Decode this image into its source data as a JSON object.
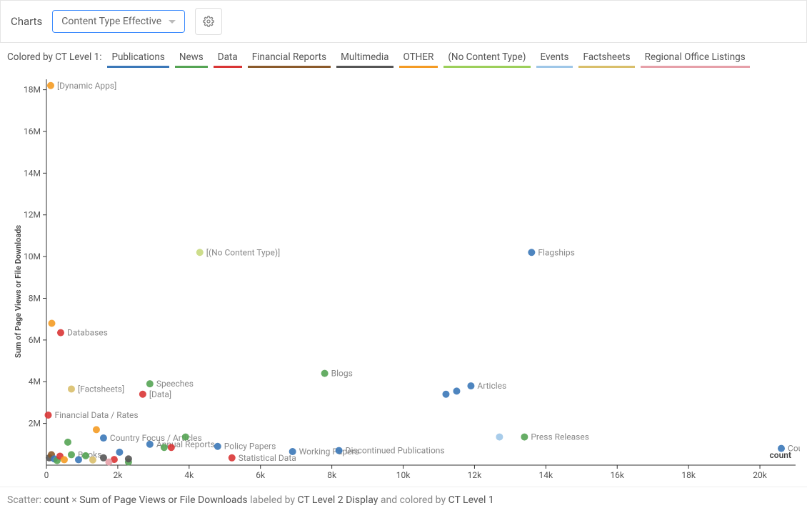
{
  "toolbar": {
    "label": "Charts",
    "dropdown_value": "Content Type Effective",
    "gear_name": "settings-icon"
  },
  "legend": {
    "label": "Colored by CT Level 1:",
    "items": [
      {
        "label": "Publications",
        "color": "#3B78B8"
      },
      {
        "label": "News",
        "color": "#55A454"
      },
      {
        "label": "Data",
        "color": "#D93535"
      },
      {
        "label": "Financial Reports",
        "color": "#8B5A2B"
      },
      {
        "label": "Multimedia",
        "color": "#555555"
      },
      {
        "label": "OTHER",
        "color": "#F49B24"
      },
      {
        "label": "(No Content Type)",
        "color": "#9CCF5A"
      },
      {
        "label": "Events",
        "color": "#9FC7E8"
      },
      {
        "label": "Factsheets",
        "color": "#D9BF6B"
      },
      {
        "label": "Regional Office Listings",
        "color": "#E6A0A9"
      }
    ]
  },
  "footer": {
    "prefix": "Scatter: ",
    "xvar": "count",
    "sep1": " × ",
    "yvar": "Sum of Page Views or File Downloads",
    "labeled_prefix": " labeled by ",
    "label_field": "CT Level 2 Display",
    "colored_prefix": " and colored by ",
    "color_field": "CT Level 1"
  },
  "chart_data": {
    "type": "scatter",
    "title": "",
    "xlabel": "count",
    "ylabel": "Sum of Page Views or File Downloads",
    "xlim": [
      0,
      21000
    ],
    "ylim": [
      0,
      18500000
    ],
    "xticks": [
      0,
      2000,
      4000,
      6000,
      8000,
      10000,
      12000,
      14000,
      16000,
      18000,
      20000
    ],
    "yticks": [
      2000000,
      4000000,
      6000000,
      8000000,
      10000000,
      12000000,
      14000000,
      16000000,
      18000000
    ],
    "xtick_labels": [
      "0",
      "2k",
      "4k",
      "6k",
      "8k",
      "10k",
      "12k",
      "14k",
      "16k",
      "18k",
      "20k"
    ],
    "ytick_labels": [
      "2M",
      "4M",
      "6M",
      "8M",
      "10M",
      "12M",
      "14M",
      "16M",
      "18M"
    ],
    "series_colors": {
      "Publications": "#3B78B8",
      "News": "#55A454",
      "Data": "#D93535",
      "Financial Reports": "#8B5A2B",
      "Multimedia": "#555555",
      "OTHER": "#F49B24",
      "(No Content Type)": "#C8D97E",
      "Events": "#9FC7E8",
      "Factsheets": "#D9BF6B",
      "Regional Office Listings": "#E6A0A9"
    },
    "points": [
      {
        "x": 120,
        "y": 18200000,
        "series": "OTHER",
        "label": "[Dynamic Apps]"
      },
      {
        "x": 4300,
        "y": 10200000,
        "series": "(No Content Type)",
        "label": "[(No Content Type)]"
      },
      {
        "x": 13600,
        "y": 10200000,
        "series": "Publications",
        "label": "Flagships"
      },
      {
        "x": 150,
        "y": 6800000,
        "series": "OTHER",
        "label": ""
      },
      {
        "x": 400,
        "y": 6350000,
        "series": "Data",
        "label": "Databases"
      },
      {
        "x": 7800,
        "y": 4400000,
        "series": "News",
        "label": "Blogs"
      },
      {
        "x": 11900,
        "y": 3800000,
        "series": "Publications",
        "label": "Articles"
      },
      {
        "x": 2900,
        "y": 3900000,
        "series": "News",
        "label": "Speeches"
      },
      {
        "x": 700,
        "y": 3650000,
        "series": "Factsheets",
        "label": "[Factsheets]"
      },
      {
        "x": 2700,
        "y": 3400000,
        "series": "Data",
        "label": "[Data]"
      },
      {
        "x": 11200,
        "y": 3400000,
        "series": "Publications",
        "label": ""
      },
      {
        "x": 11500,
        "y": 3550000,
        "series": "Publications",
        "label": ""
      },
      {
        "x": 50,
        "y": 2400000,
        "series": "Data",
        "label": "Financial Data / Rates"
      },
      {
        "x": 1400,
        "y": 1700000,
        "series": "OTHER",
        "label": ""
      },
      {
        "x": 600,
        "y": 1100000,
        "series": "News",
        "label": ""
      },
      {
        "x": 1600,
        "y": 1300000,
        "series": "Publications",
        "label": "Country Focus / Articles"
      },
      {
        "x": 2900,
        "y": 1000000,
        "series": "Publications",
        "label": "Annual Reports"
      },
      {
        "x": 3300,
        "y": 850000,
        "series": "News",
        "label": ""
      },
      {
        "x": 3500,
        "y": 850000,
        "series": "Data",
        "label": ""
      },
      {
        "x": 3900,
        "y": 1350000,
        "series": "News",
        "label": ""
      },
      {
        "x": 4800,
        "y": 900000,
        "series": "Publications",
        "label": "Policy Papers"
      },
      {
        "x": 5200,
        "y": 350000,
        "series": "Data",
        "label": "Statistical Data"
      },
      {
        "x": 6900,
        "y": 650000,
        "series": "Publications",
        "label": "Working Papers"
      },
      {
        "x": 8200,
        "y": 700000,
        "series": "Publications",
        "label": "Discontinued Publications"
      },
      {
        "x": 12700,
        "y": 1350000,
        "series": "Events",
        "label": ""
      },
      {
        "x": 13400,
        "y": 1350000,
        "series": "News",
        "label": "Press Releases"
      },
      {
        "x": 20600,
        "y": 800000,
        "series": "Publications",
        "label": "Country Re"
      },
      {
        "x": 700,
        "y": 500000,
        "series": "News",
        "label": "Books"
      },
      {
        "x": 80,
        "y": 350000,
        "series": "Multimedia",
        "label": ""
      },
      {
        "x": 140,
        "y": 500000,
        "series": "Financial Reports",
        "label": ""
      },
      {
        "x": 220,
        "y": 300000,
        "series": "Publications",
        "label": ""
      },
      {
        "x": 300,
        "y": 220000,
        "series": "News",
        "label": ""
      },
      {
        "x": 380,
        "y": 430000,
        "series": "Data",
        "label": ""
      },
      {
        "x": 500,
        "y": 260000,
        "series": "OTHER",
        "label": ""
      },
      {
        "x": 900,
        "y": 260000,
        "series": "Publications",
        "label": ""
      },
      {
        "x": 1100,
        "y": 450000,
        "series": "News",
        "label": ""
      },
      {
        "x": 1300,
        "y": 250000,
        "series": "Factsheets",
        "label": ""
      },
      {
        "x": 1600,
        "y": 350000,
        "series": "Multimedia",
        "label": ""
      },
      {
        "x": 1900,
        "y": 270000,
        "series": "Data",
        "label": ""
      },
      {
        "x": 2050,
        "y": 620000,
        "series": "Publications",
        "label": ""
      },
      {
        "x": 2300,
        "y": 150000,
        "series": "News",
        "label": ""
      },
      {
        "x": 2300,
        "y": 300000,
        "series": "Multimedia",
        "label": ""
      },
      {
        "x": 1750,
        "y": 150000,
        "series": "Regional Office Listings",
        "label": ""
      }
    ]
  }
}
